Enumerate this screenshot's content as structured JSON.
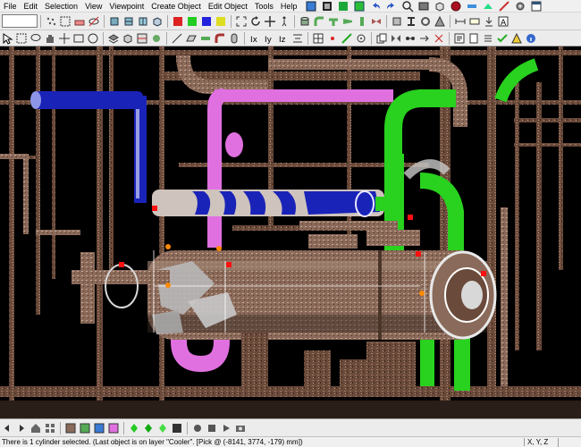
{
  "menu": {
    "items": [
      "File",
      "Edit",
      "Selection",
      "View",
      "Viewpoint",
      "Create Object",
      "Edit Object",
      "Tools",
      "Help"
    ]
  },
  "status": {
    "message": "There is 1 cylinder selected. (Last object is on layer \"Cooler\". [Pick @ (-8141, 3774, -179) mm])",
    "coord_mode": "X, Y, Z"
  },
  "colors": {
    "pipe_magenta": "#e070e0",
    "pipe_blue": "#1a23b8",
    "pipe_green": "#28d21e",
    "selection_marker": "#ff1010",
    "snap_point": "#ff8a00"
  }
}
